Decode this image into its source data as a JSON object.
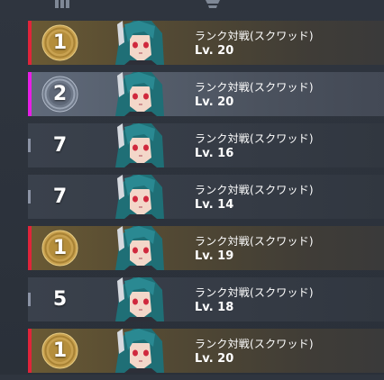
{
  "header": {
    "left_icon": "stats-bars-icon",
    "right_icon": "rank-emblem-icon"
  },
  "matches": [
    {
      "place": "1",
      "mode": "ランク対戦(スクワッド)",
      "level": "Lv. 20",
      "tier": "gold",
      "accent": "#e0243a"
    },
    {
      "place": "2",
      "mode": "ランク対戦(スクワッド)",
      "level": "Lv. 20",
      "tier": "silver",
      "accent": "#e61ee6"
    },
    {
      "place": "7",
      "mode": "ランク対戦(スクワッド)",
      "level": "Lv. 16",
      "tier": "plain",
      "accent": "#8b93a5"
    },
    {
      "place": "7",
      "mode": "ランク対戦(スクワッド)",
      "level": "Lv. 14",
      "tier": "plain",
      "accent": "#8b93a5"
    },
    {
      "place": "1",
      "mode": "ランク対戦(スクワッド)",
      "level": "Lv. 19",
      "tier": "gold",
      "accent": "#e0243a"
    },
    {
      "place": "5",
      "mode": "ランク対戦(スクワッド)",
      "level": "Lv. 18",
      "tier": "plain",
      "accent": "#8b93a5"
    },
    {
      "place": "1",
      "mode": "ランク対戦(スクワッド)",
      "level": "Lv. 20",
      "tier": "gold",
      "accent": "#e0243a"
    }
  ]
}
